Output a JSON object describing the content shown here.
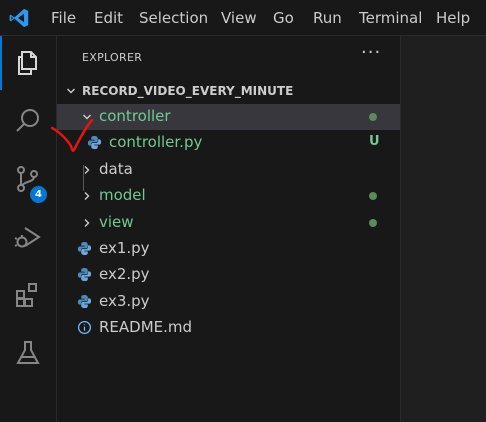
{
  "menu": {
    "items": [
      "File",
      "Edit",
      "Selection",
      "View",
      "Go",
      "Run",
      "Terminal",
      "Help"
    ]
  },
  "activity_bar": {
    "icons": [
      "files-icon",
      "search-icon",
      "source-control-icon",
      "run-debug-icon",
      "extensions-icon",
      "testing-icon"
    ],
    "scm_badge": "4"
  },
  "explorer": {
    "title": "EXPLORER",
    "more_actions": "···",
    "workspace_name": "RECORD_VIDEO_EVERY_MINUTE",
    "tree": [
      {
        "label": "controller",
        "kind": "folder",
        "expanded": true,
        "decoration": "dot",
        "color": "#73c991",
        "selected": true
      },
      {
        "label": "controller.py",
        "kind": "python",
        "decoration": "U",
        "color": "#73c991"
      },
      {
        "label": "data",
        "kind": "folder",
        "expanded": false,
        "color": "#cccccc"
      },
      {
        "label": "model",
        "kind": "folder",
        "expanded": false,
        "decoration": "dot",
        "color": "#73c991"
      },
      {
        "label": "view",
        "kind": "folder",
        "expanded": false,
        "decoration": "dot",
        "color": "#73c991"
      },
      {
        "label": "ex1.py",
        "kind": "python",
        "color": "#cccccc"
      },
      {
        "label": "ex2.py",
        "kind": "python",
        "color": "#cccccc"
      },
      {
        "label": "ex3.py",
        "kind": "python",
        "color": "#cccccc"
      },
      {
        "label": "README.md",
        "kind": "info",
        "color": "#cccccc"
      }
    ]
  },
  "colors": {
    "accent": "#0078d4",
    "git_untracked": "#73c991",
    "annotation": "#e51414"
  }
}
